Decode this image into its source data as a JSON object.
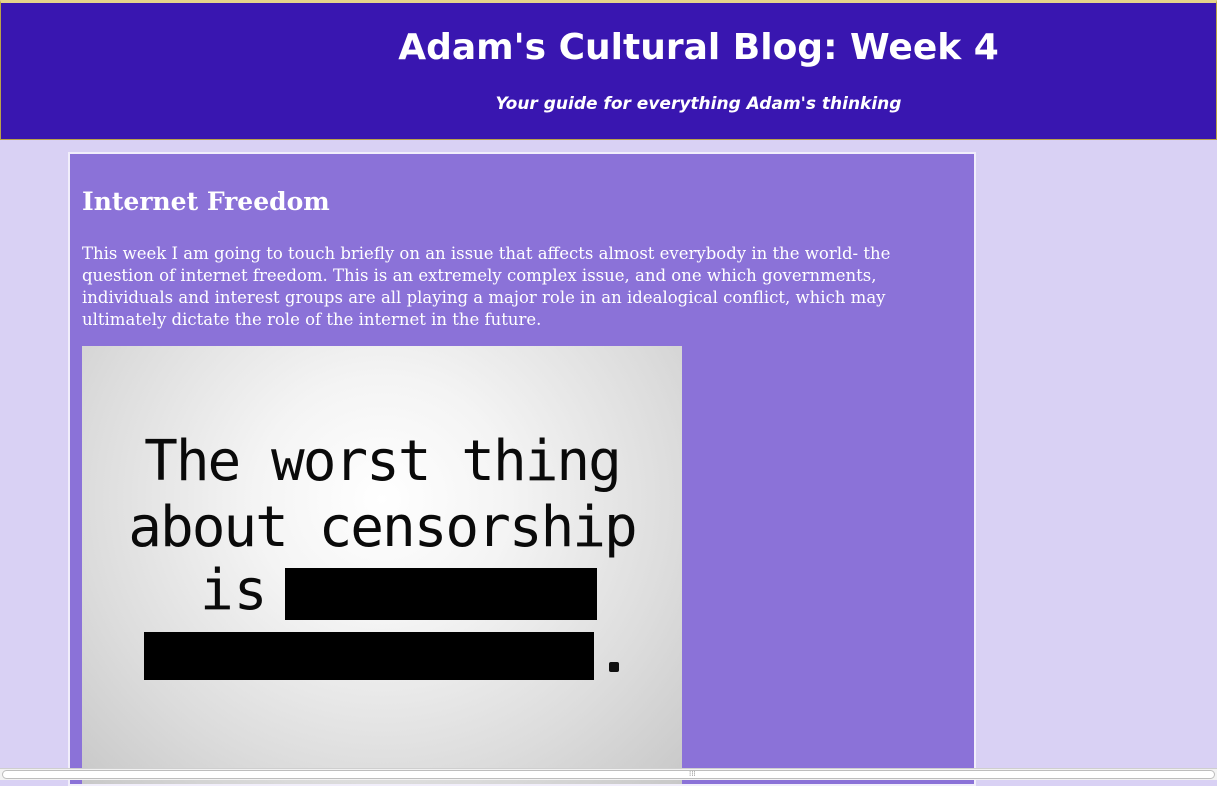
{
  "header": {
    "title": "Adam's Cultural Blog: Week 4",
    "tagline": "Your guide for everything Adam's thinking"
  },
  "post": {
    "title": "Internet Freedom",
    "body": "This week I am going to touch briefly on an issue that affects almost everybody in the world- the question of internet freedom. This is an extremely complex issue, and one which governments, individuals and interest groups are all playing a major role in an idealogical conflict, which may ultimately dictate the role of the internet in the future.",
    "image": {
      "line1": "The worst thing",
      "line2": "about censorship",
      "line3": "is",
      "period": "."
    }
  },
  "colors": {
    "header_bg": "#3916b0",
    "page_bg": "#d9d1f4",
    "post_bg": "#8b72d8",
    "text": "#ffffff"
  },
  "scrollbar": {
    "grip": "⁞⁞⁞"
  }
}
